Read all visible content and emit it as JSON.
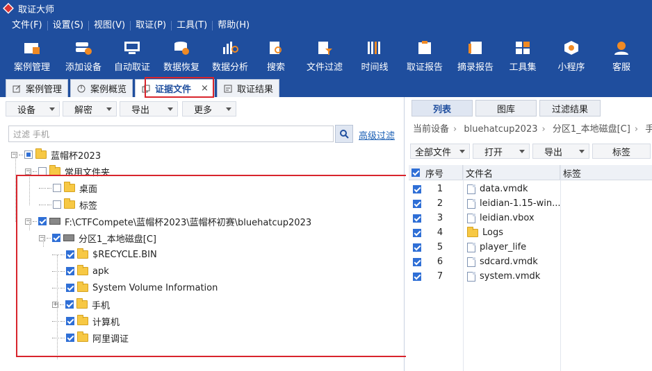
{
  "window": {
    "title": "取证大师"
  },
  "menu": [
    "文件(F)",
    "设置(S)",
    "视图(V)",
    "取证(P)",
    "工具(T)",
    "帮助(H)"
  ],
  "toolbar": [
    {
      "label": "案例管理",
      "icon": "case-management-icon",
      "color": "#ffffff"
    },
    {
      "label": "添加设备",
      "icon": "add-device-icon",
      "color": "#f08a24"
    },
    {
      "label": "自动取证",
      "icon": "auto-forensics-icon",
      "color": "#ffffff"
    },
    {
      "label": "数据恢复",
      "icon": "data-recovery-icon",
      "color": "#f08a24"
    },
    {
      "label": "数据分析",
      "icon": "data-analysis-icon",
      "color": "#f08a24"
    },
    {
      "label": "搜索",
      "icon": "search-doc-icon",
      "color": "#f08a24"
    },
    {
      "label": "文件过滤",
      "icon": "file-filter-icon",
      "color": "#ffffff"
    },
    {
      "label": "时间线",
      "icon": "timeline-icon",
      "color": "#ffffff"
    },
    {
      "label": "取证报告",
      "icon": "forensics-report-icon",
      "color": "#ffffff"
    },
    {
      "label": "摘录报告",
      "icon": "excerpt-report-icon",
      "color": "#ffffff"
    },
    {
      "label": "工具集",
      "icon": "toolset-icon",
      "color": "#ffffff"
    },
    {
      "label": "小程序",
      "icon": "mini-program-icon",
      "color": "#f08a24"
    },
    {
      "label": "客服",
      "icon": "customer-service-icon",
      "color": "#f08a24"
    }
  ],
  "tabs": [
    {
      "label": "案例管理",
      "icon": "edit-icon",
      "active": false,
      "closable": false
    },
    {
      "label": "案例概览",
      "icon": "chart-pie-icon",
      "active": false,
      "closable": false
    },
    {
      "label": "证据文件",
      "icon": "doc-copy-icon",
      "active": true,
      "closable": true,
      "close": "×"
    },
    {
      "label": "取证结果",
      "icon": "result-icon",
      "active": false,
      "closable": false
    }
  ],
  "left": {
    "tools": [
      "设备",
      "解密",
      "导出",
      "更多"
    ],
    "search_placeholder": "过滤 手机",
    "advanced_filter": "高级过滤",
    "tree": [
      {
        "label": "蓝帽杯2023",
        "level": 0,
        "exp": "−",
        "check": "part",
        "type": "folder"
      },
      {
        "label": "常用文件夹",
        "level": 1,
        "exp": "−",
        "check": "off",
        "type": "folder"
      },
      {
        "label": "桌面",
        "level": 2,
        "exp": "",
        "check": "off",
        "type": "folder"
      },
      {
        "label": "标签",
        "level": 2,
        "exp": "",
        "check": "off",
        "type": "folder"
      },
      {
        "label": "F:\\CTFCompete\\蓝帽杯2023\\蓝帽杯初赛\\bluehatcup2023",
        "level": 1,
        "exp": "−",
        "check": "on",
        "type": "disk"
      },
      {
        "label": "分区1_本地磁盘[C]",
        "level": 2,
        "exp": "−",
        "check": "on",
        "type": "disk"
      },
      {
        "label": "$RECYCLE.BIN",
        "level": 3,
        "exp": "",
        "check": "on",
        "type": "folder"
      },
      {
        "label": "apk",
        "level": 3,
        "exp": "",
        "check": "on",
        "type": "folder"
      },
      {
        "label": "System Volume Information",
        "level": 3,
        "exp": "",
        "check": "on",
        "type": "folder"
      },
      {
        "label": "手机",
        "level": 3,
        "exp": "+",
        "check": "on",
        "type": "folder"
      },
      {
        "label": "计算机",
        "level": 3,
        "exp": "",
        "check": "on",
        "type": "folder"
      },
      {
        "label": "阿里调证",
        "level": 3,
        "exp": "",
        "check": "on",
        "type": "folder"
      }
    ]
  },
  "right": {
    "tabs": [
      "列表",
      "图库",
      "过滤结果"
    ],
    "breadcrumb": [
      "当前设备",
      "bluehatcup2023",
      "分区1_本地磁盘[C]",
      "手"
    ],
    "tools": [
      "全部文件",
      "打开",
      "导出",
      "标签"
    ],
    "columns": [
      "序号",
      "文件名",
      "标签"
    ],
    "rows": [
      {
        "no": "1",
        "name": "data.vmdk",
        "type": "file"
      },
      {
        "no": "2",
        "name": "leidian-1.15-win...",
        "type": "file"
      },
      {
        "no": "3",
        "name": "leidian.vbox",
        "type": "file"
      },
      {
        "no": "4",
        "name": "Logs",
        "type": "folder"
      },
      {
        "no": "5",
        "name": "player_life",
        "type": "file"
      },
      {
        "no": "6",
        "name": "sdcard.vmdk",
        "type": "file"
      },
      {
        "no": "7",
        "name": "system.vmdk",
        "type": "file"
      }
    ]
  },
  "colors": {
    "brand": "#1f4e9e",
    "highlight": "#d8242c",
    "accent": "#f08a24",
    "link": "#1a5fb4"
  }
}
